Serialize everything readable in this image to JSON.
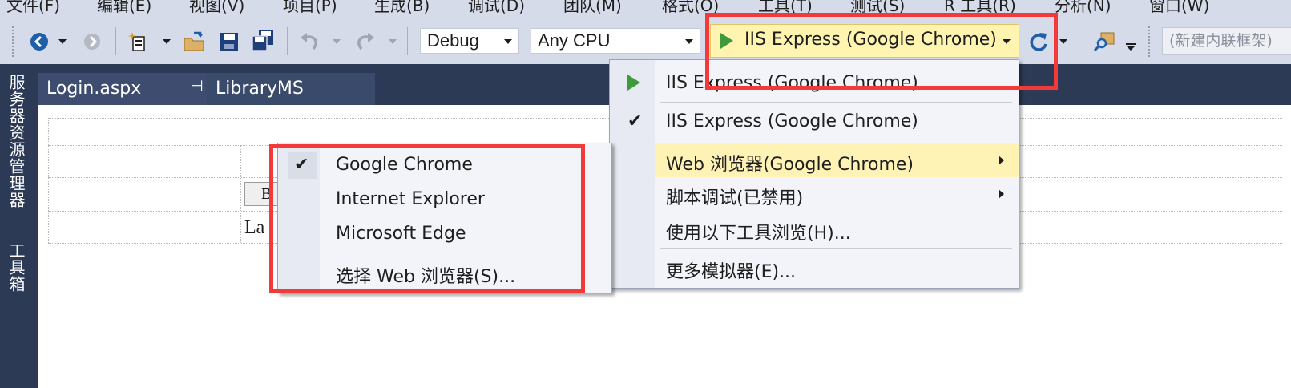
{
  "menubar": {
    "items": [
      "文件(F)",
      "编辑(E)",
      "视图(V)",
      "项目(P)",
      "生成(B)",
      "调试(D)",
      "团队(M)",
      "格式(O)",
      "工具(T)",
      "测试(S)",
      "R 工具(R)",
      "分析(N)",
      "窗口(W)"
    ]
  },
  "toolbar": {
    "config": "Debug",
    "platform": "Any CPU",
    "run_target": "IIS Express (Google Chrome)",
    "search_placeholder": "(新建内联框架)"
  },
  "side_strip": {
    "server_explorer": "服务器资源管理器",
    "toolbox": "工具箱"
  },
  "tabs": [
    {
      "label": "Login.aspx",
      "pin": "⊣",
      "close": "✕"
    },
    {
      "label": "LibraryMS"
    }
  ],
  "designer": {
    "button_text": "B",
    "label_text": "La"
  },
  "run_menu": {
    "items": [
      {
        "label": "IIS Express (Google Chrome)",
        "icon": "play-icon"
      },
      {
        "label": "IIS Express (Google Chrome)",
        "check": "✔"
      },
      {
        "label": "Web 浏览器(Google Chrome)",
        "highlighted": true,
        "submenu": true
      },
      {
        "label": "脚本调试(已禁用)",
        "submenu": true
      },
      {
        "label": "使用以下工具浏览(H)..."
      },
      {
        "label": "更多模拟器(E)..."
      }
    ]
  },
  "browser_menu": {
    "items": [
      {
        "label": "Google Chrome",
        "check": "✔"
      },
      {
        "label": "Internet Explorer"
      },
      {
        "label": "Microsoft Edge"
      },
      {
        "label": "选择 Web 浏览器(S)..."
      }
    ]
  },
  "colors": {
    "highlight_box": "#f23a3a",
    "run_target_bg": "#fff4b0",
    "menu_highlight": "#fff2b5",
    "ide_dark": "#2d3a56"
  }
}
